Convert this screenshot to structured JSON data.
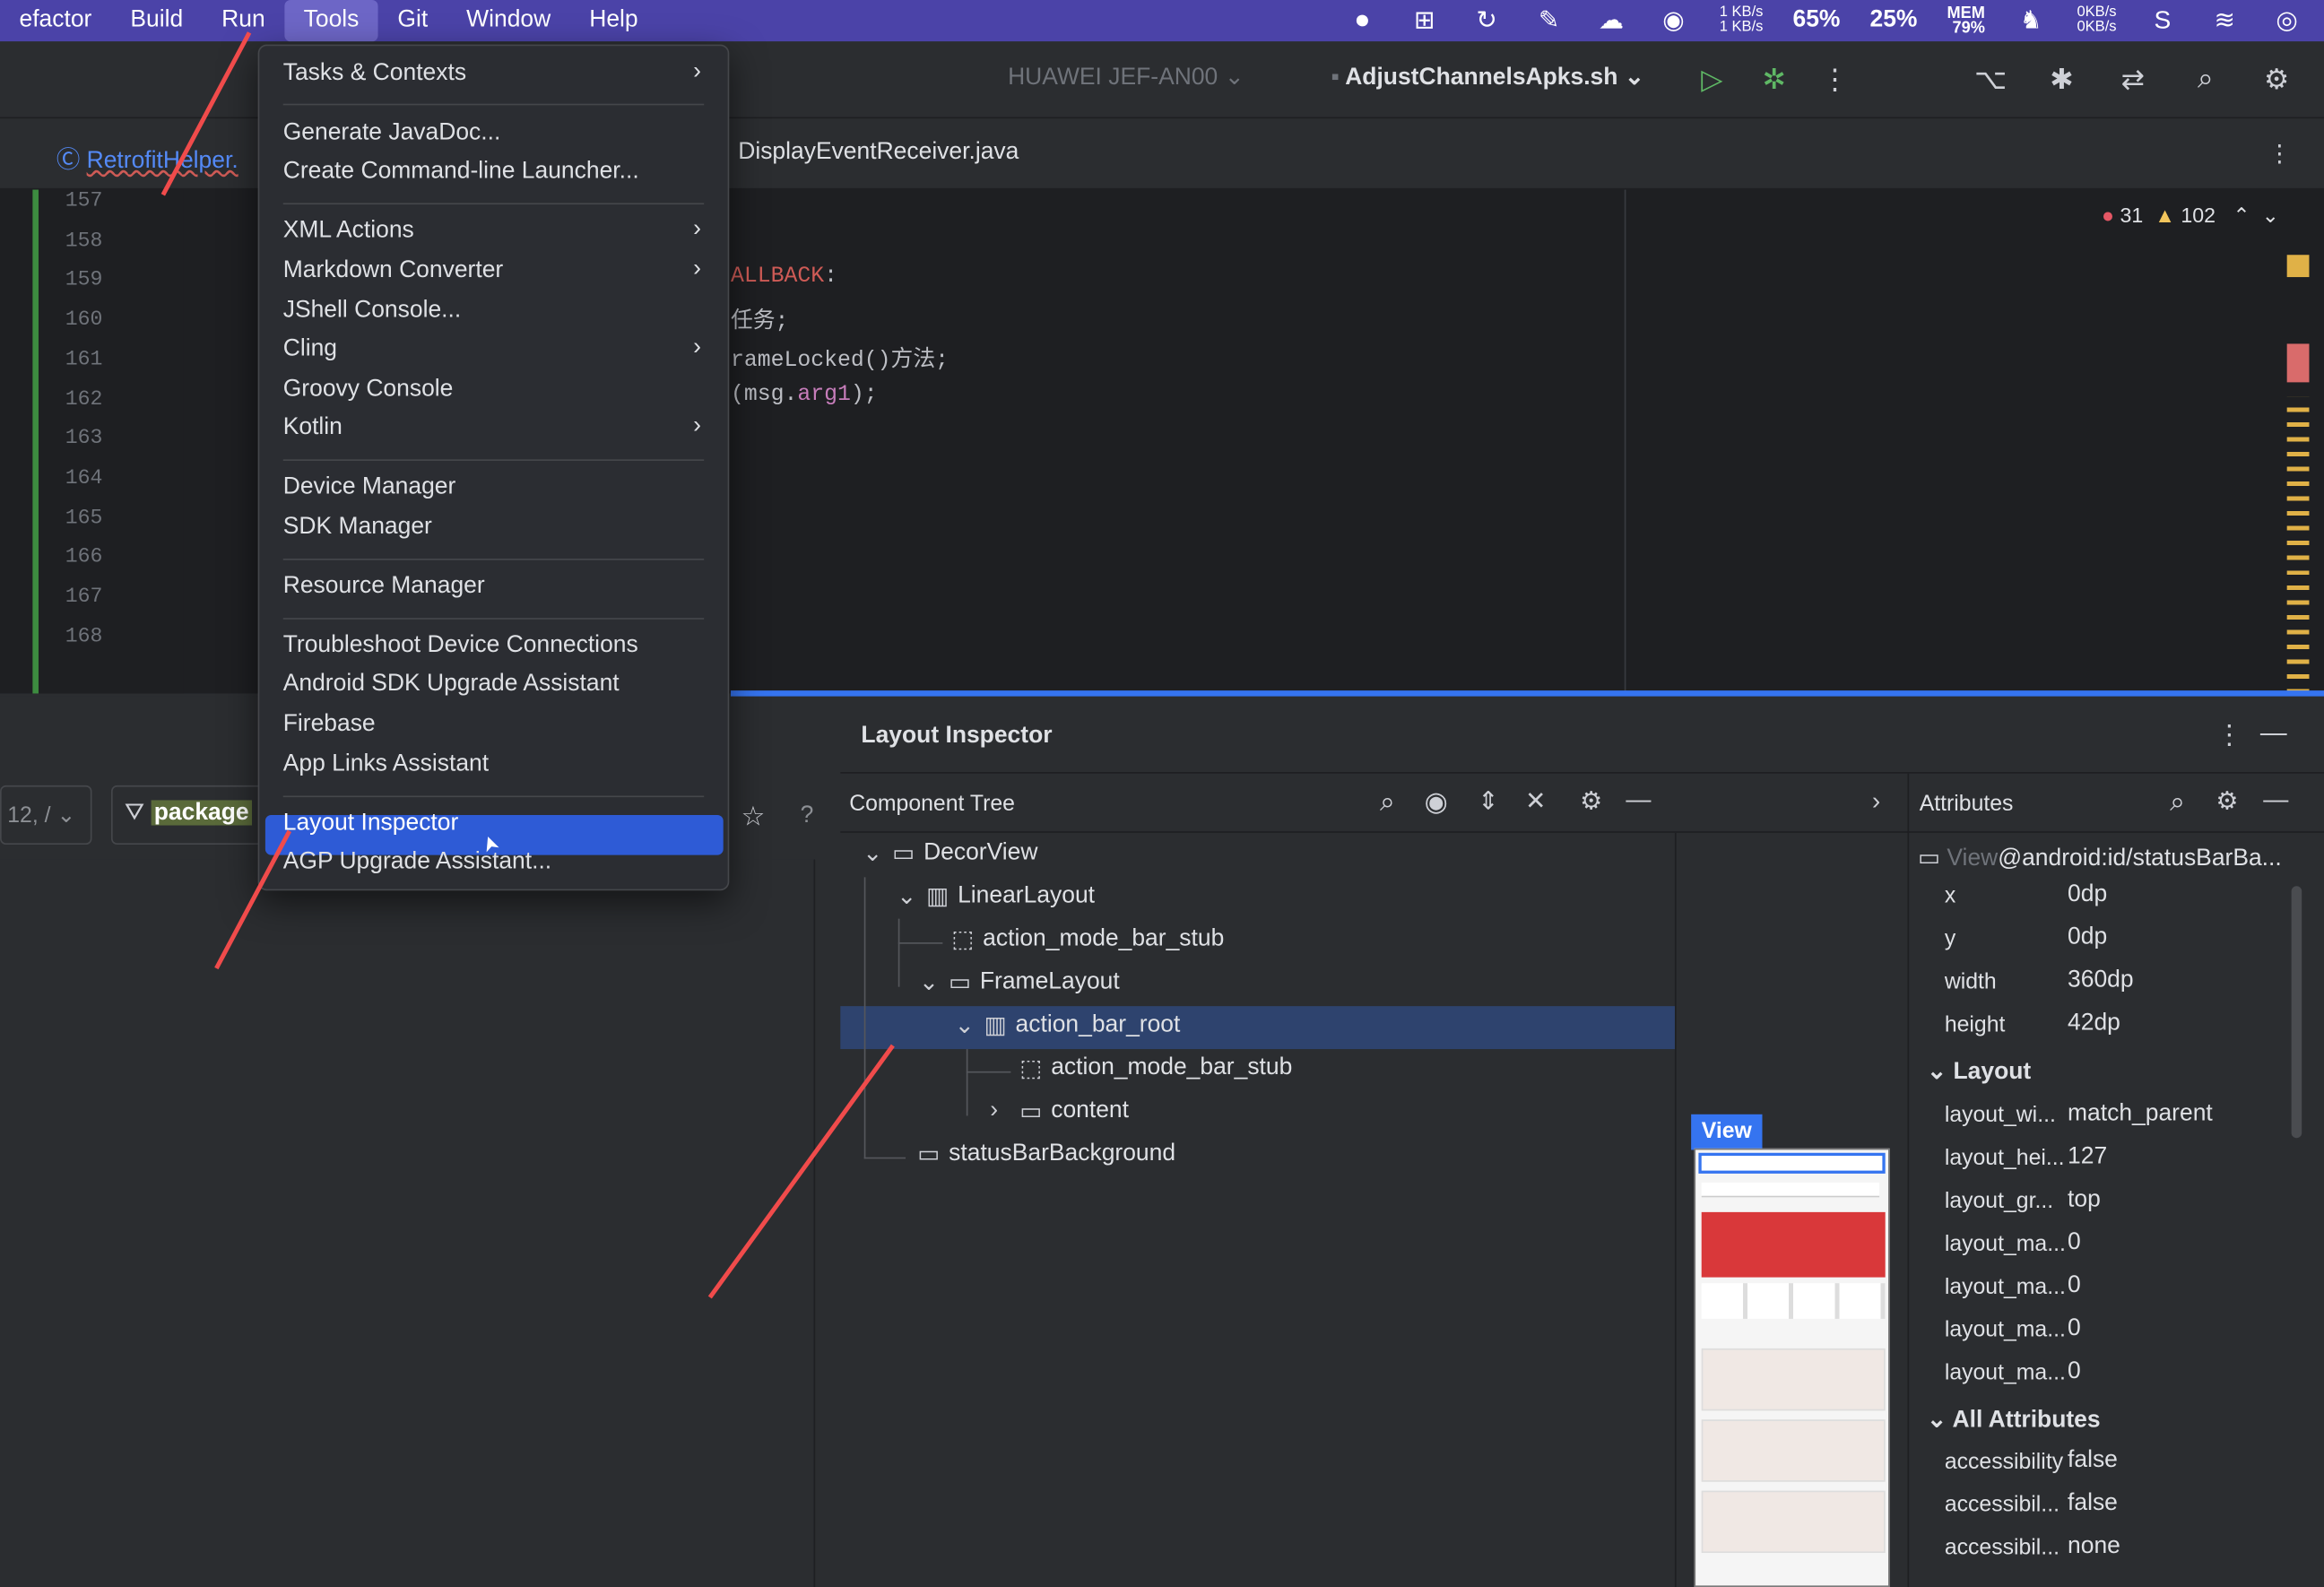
{
  "menubar": {
    "items": [
      "efactor",
      "Build",
      "Run",
      "Tools",
      "Git",
      "Window",
      "Help"
    ],
    "status": {
      "net_up": "1 KB/s",
      "net_down": "1 KB/s",
      "battery": "65%",
      "cpu": "25%",
      "mem_label": "MEM",
      "mem": "79%",
      "disk_up": "0KB/s",
      "disk_down": "0KB/s"
    }
  },
  "toolbar": {
    "device": "HUAWEI JEF-AN00",
    "run_config": "AdjustChannelsApks.sh"
  },
  "tabs": {
    "left": "RetrofitHelper.",
    "right": "DisplayEventReceiver.java"
  },
  "editor": {
    "line_numbers": [
      "157",
      "158",
      "159",
      "160",
      "161",
      "162",
      "163",
      "164",
      "165",
      "166",
      "167",
      "168"
    ],
    "code": [
      {
        "parts": [
          {
            "t": "ALLBACK",
            "c": "k-red"
          },
          {
            "t": ":",
            "c": ""
          }
        ]
      },
      {
        "parts": [
          {
            "t": "任务;",
            "c": ""
          }
        ]
      },
      {
        "parts": [
          {
            "t": "rameLocked()方法;",
            "c": ""
          }
        ]
      },
      {
        "parts": [
          {
            "t": "(msg.",
            "c": ""
          },
          {
            "t": "arg1",
            "c": "k-pur"
          },
          {
            "t": ");",
            "c": ""
          }
        ]
      }
    ],
    "errors": "31",
    "warnings": "102"
  },
  "left_panel": {
    "field": "12, /",
    "filter": "package"
  },
  "layout_inspector": {
    "title": "Layout Inspector",
    "component_tree": "Component Tree",
    "attributes": "Attributes",
    "tree": [
      {
        "label": "DecorView"
      },
      {
        "label": "LinearLayout"
      },
      {
        "label": "action_mode_bar_stub"
      },
      {
        "label": "FrameLayout"
      },
      {
        "label": "action_bar_root"
      },
      {
        "label": "action_mode_bar_stub"
      },
      {
        "label": "content"
      },
      {
        "label": "statusBarBackground"
      }
    ],
    "selected_view": {
      "prefix": "View",
      "id": "@android:id/statusBarBa..."
    },
    "attrs": [
      {
        "k": "x",
        "v": "0dp"
      },
      {
        "k": "y",
        "v": "0dp"
      },
      {
        "k": "width",
        "v": "360dp"
      },
      {
        "k": "height",
        "v": "42dp"
      }
    ],
    "layout_section": "Layout",
    "layout_attrs": [
      {
        "k": "layout_wi...",
        "v": "match_parent"
      },
      {
        "k": "layout_hei...",
        "v": "127"
      },
      {
        "k": "layout_gr...",
        "v": "top"
      },
      {
        "k": "layout_ma...",
        "v": "0"
      },
      {
        "k": "layout_ma...",
        "v": "0"
      },
      {
        "k": "layout_ma...",
        "v": "0"
      },
      {
        "k": "layout_ma...",
        "v": "0"
      }
    ],
    "all_section": "All Attributes",
    "all_attrs": [
      {
        "k": "accessibility",
        "v": "false"
      },
      {
        "k": "accessibil...",
        "v": "false"
      },
      {
        "k": "accessibil...",
        "v": "none"
      }
    ],
    "preview_label": "View"
  },
  "tools_menu": {
    "items": [
      {
        "label": "Tasks & Contexts",
        "sub": true
      },
      {
        "label": "Generate JavaDoc..."
      },
      {
        "label": "Create Command-line Launcher..."
      },
      {
        "label": "XML Actions",
        "sub": true
      },
      {
        "label": "Markdown Converter",
        "sub": true
      },
      {
        "label": "JShell Console..."
      },
      {
        "label": "Cling",
        "sub": true
      },
      {
        "label": "Groovy Console"
      },
      {
        "label": "Kotlin",
        "sub": true
      },
      {
        "label": "Device Manager"
      },
      {
        "label": "SDK Manager"
      },
      {
        "label": "Resource Manager"
      },
      {
        "label": "Troubleshoot Device Connections"
      },
      {
        "label": "Android SDK Upgrade Assistant"
      },
      {
        "label": "Firebase"
      },
      {
        "label": "App Links Assistant"
      },
      {
        "label": "Layout Inspector",
        "highlight": true
      },
      {
        "label": "AGP Upgrade Assistant..."
      }
    ]
  },
  "colors": {
    "menubar": "#4b43a8",
    "accent": "#3574f0",
    "highlight": "#2e5bd6",
    "annotation": "#f04b4b"
  }
}
